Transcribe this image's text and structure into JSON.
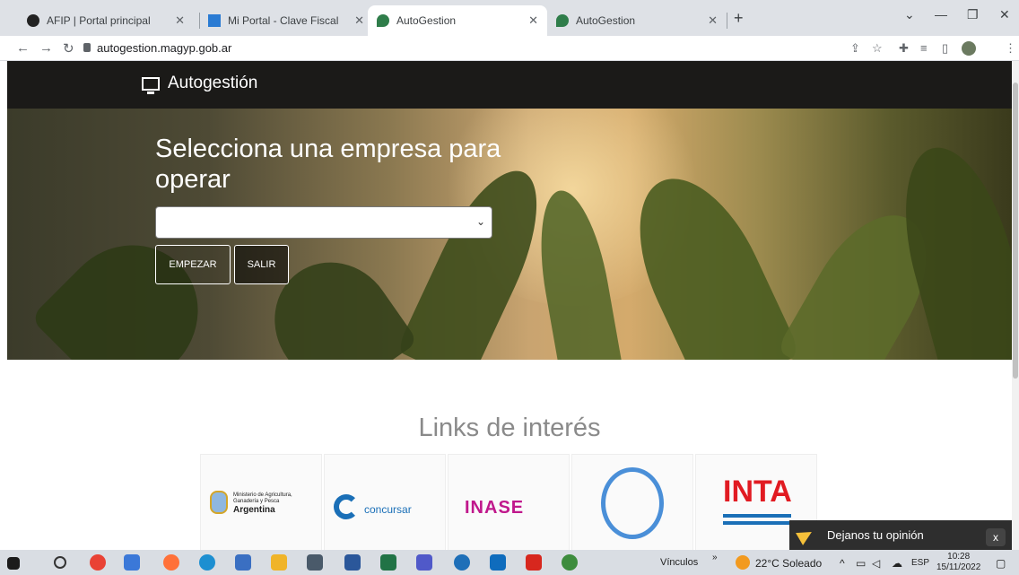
{
  "browser": {
    "tabs": [
      {
        "title": "AFIP | Portal principal",
        "active": false
      },
      {
        "title": "Mi Portal - Clave Fiscal",
        "active": false
      },
      {
        "title": "AutoGestion",
        "active": true
      },
      {
        "title": "AutoGestion",
        "active": false
      }
    ],
    "url": "autogestion.magyp.gob.ar"
  },
  "header": {
    "brand": "Autogestión"
  },
  "hero": {
    "title": "Selecciona una empresa para operar",
    "select_value": "",
    "start_button": "EMPEZAR",
    "exit_button": "SALIR"
  },
  "links": {
    "title": "Links de interés",
    "cards": [
      {
        "line1": "Ministerio de Agricultura,",
        "line2": "Ganadería y Pesca",
        "line3": "Argentina"
      },
      {
        "label": "concursar"
      },
      {
        "label": "INASE"
      },
      {
        "label": ""
      },
      {
        "label": "INTA"
      }
    ]
  },
  "feedback": {
    "label": "Dejanos tu opinión",
    "close": "x"
  },
  "taskbar": {
    "links_label": "Vínculos",
    "weather": "22°C Soleado",
    "language": "ESP",
    "time": "10:28",
    "date": "15/11/2022"
  },
  "colors": {
    "header": "#1b1a18",
    "inta_red": "#e11b22",
    "concursar_blue": "#1a6fb7"
  }
}
